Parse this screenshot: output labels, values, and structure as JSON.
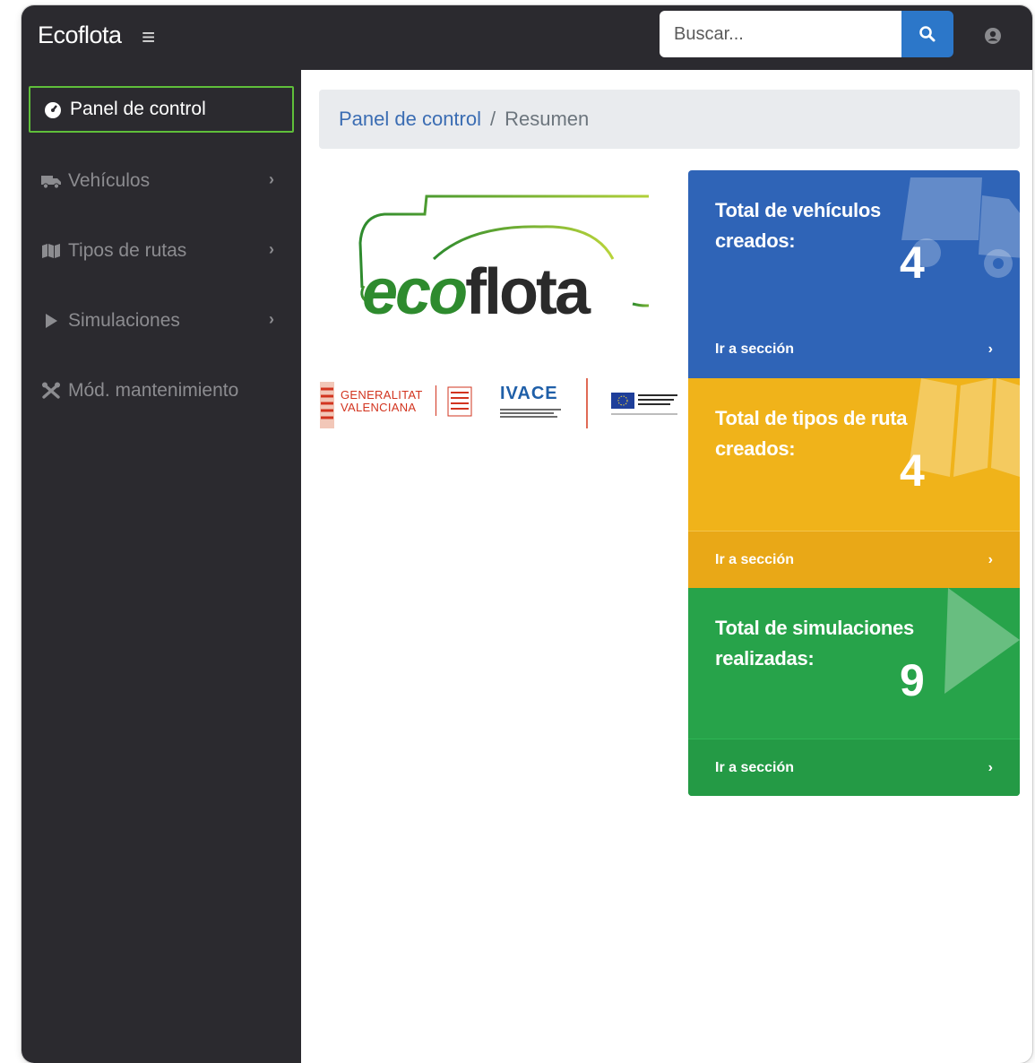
{
  "app": {
    "brand": "Ecoflota"
  },
  "search": {
    "placeholder": "Buscar..."
  },
  "sidebar": {
    "items": [
      {
        "label": "Panel de control"
      },
      {
        "label": "Vehículos"
      },
      {
        "label": "Tipos de rutas"
      },
      {
        "label": "Simulaciones"
      },
      {
        "label": "Mód. mantenimiento"
      }
    ]
  },
  "breadcrumb": {
    "link": "Panel de control",
    "separator": "/",
    "current": "Resumen"
  },
  "logo": {
    "eco": "eco",
    "flota": "flota"
  },
  "sponsors": {
    "generalitat_line1": "GENERALITAT",
    "generalitat_line2": "VALENCIANA",
    "ivace": "IVACE"
  },
  "cards": [
    {
      "title": "Total de vehículos creados:",
      "value": "4",
      "link": "Ir a sección",
      "color": "#2f64b7"
    },
    {
      "title": "Total de tipos de ruta creados:",
      "value": "4",
      "link": "Ir a sección",
      "color": "#f0b31a"
    },
    {
      "title": "Total de simulaciones realizadas:",
      "value": "9",
      "link": "Ir a sección",
      "color": "#27a34a"
    }
  ],
  "colors": {
    "sidebar": "#2b2a2f",
    "active_border": "#5fbf3a",
    "search_button": "#2c77c9"
  }
}
